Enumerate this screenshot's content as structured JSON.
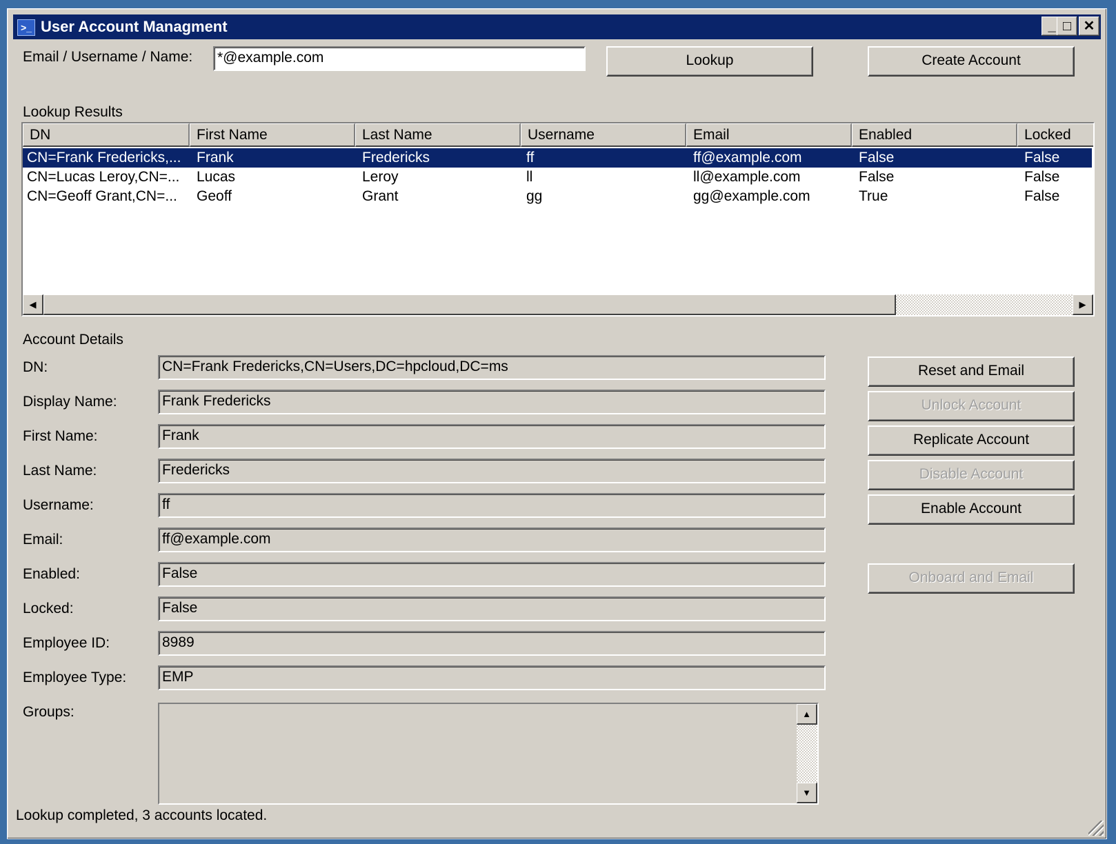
{
  "window": {
    "title": "User Account Managment",
    "icon": "powershell-icon",
    "controls": {
      "minimize": "_",
      "maximize": "□",
      "close": "✕"
    }
  },
  "search": {
    "label": "Email / Username / Name:",
    "value": "*@example.com",
    "lookup_label": "Lookup",
    "create_label": "Create Account"
  },
  "results": {
    "label": "Lookup Results",
    "columns": [
      "DN",
      "First Name",
      "Last Name",
      "Username",
      "Email",
      "Enabled",
      "Locked"
    ],
    "rows": [
      {
        "dn": "CN=Frank Fredericks,...",
        "first": "Frank",
        "last": "Fredericks",
        "username": "ff",
        "email": "ff@example.com",
        "enabled": "False",
        "locked": "False",
        "selected": true
      },
      {
        "dn": "CN=Lucas Leroy,CN=...",
        "first": "Lucas",
        "last": "Leroy",
        "username": "ll",
        "email": "ll@example.com",
        "enabled": "False",
        "locked": "False",
        "selected": false
      },
      {
        "dn": "CN=Geoff Grant,CN=...",
        "first": "Geoff",
        "last": "Grant",
        "username": "gg",
        "email": "gg@example.com",
        "enabled": "True",
        "locked": "False",
        "selected": false
      }
    ],
    "scroll": {
      "left_arrow": "◀",
      "right_arrow": "▶"
    }
  },
  "details": {
    "label": "Account Details",
    "fields": [
      {
        "label": "DN:",
        "value": "CN=Frank Fredericks,CN=Users,DC=hpcloud,DC=ms"
      },
      {
        "label": "Display Name:",
        "value": "Frank Fredericks"
      },
      {
        "label": "First Name:",
        "value": "Frank"
      },
      {
        "label": "Last Name:",
        "value": "Fredericks"
      },
      {
        "label": "Username:",
        "value": "ff"
      },
      {
        "label": "Email:",
        "value": "ff@example.com"
      },
      {
        "label": "Enabled:",
        "value": "False"
      },
      {
        "label": "Locked:",
        "value": "False"
      },
      {
        "label": "Employee ID:",
        "value": "8989"
      },
      {
        "label": "Employee Type:",
        "value": "EMP"
      }
    ],
    "groups_label": "Groups:",
    "groups_scroll": {
      "up_arrow": "▲",
      "down_arrow": "▼"
    }
  },
  "actions": {
    "reset_email": "Reset and Email",
    "unlock": "Unlock Account",
    "replicate": "Replicate Account",
    "disable": "Disable Account",
    "enable": "Enable Account",
    "onboard_email": "Onboard and Email"
  },
  "status": "Lookup completed, 3 accounts located."
}
